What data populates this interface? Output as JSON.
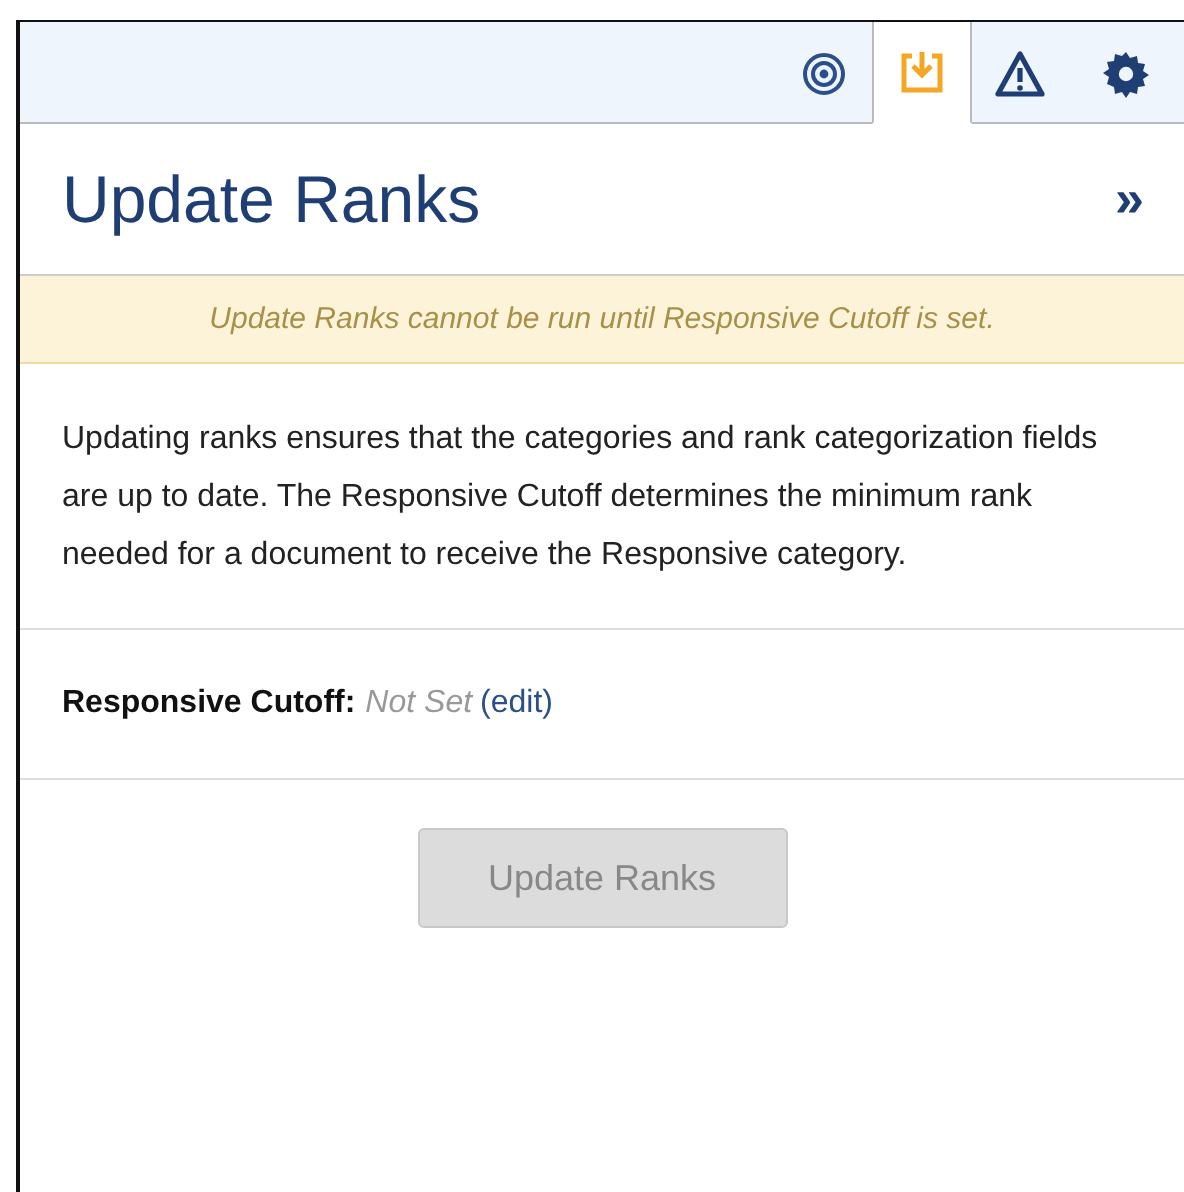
{
  "tabs": [
    {
      "kind": "target",
      "selected": false
    },
    {
      "kind": "download",
      "selected": true
    },
    {
      "kind": "warning",
      "selected": false
    },
    {
      "kind": "settings",
      "selected": false
    }
  ],
  "panel": {
    "title": "Update Ranks",
    "collapse": "»"
  },
  "notice": "Update Ranks cannot be run until Responsive Cutoff is set.",
  "description": "Updating ranks ensures that the categories and rank categorization fields are up to date. The Responsive Cutoff determines the minimum rank needed for a document to receive the Responsive category.",
  "cutoff": {
    "label": "Responsive Cutoff:",
    "value": "Not Set",
    "open": "(",
    "link": "edit",
    "close": ")"
  },
  "button": {
    "label": "Update Ranks",
    "disabled": true
  }
}
